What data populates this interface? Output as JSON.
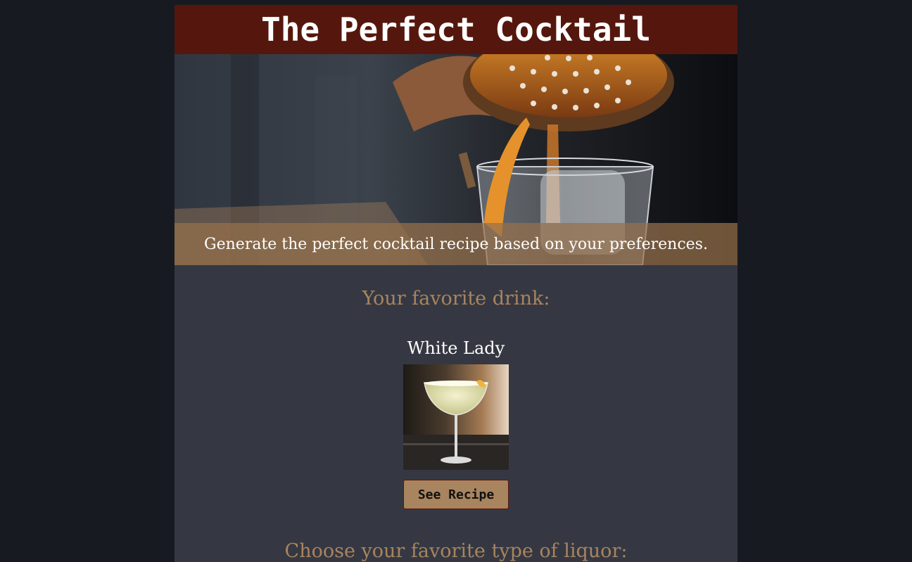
{
  "header": {
    "title": "The Perfect Cocktail"
  },
  "hero": {
    "image_name": "cocktail-pouring-image",
    "caption": "Generate the perfect cocktail recipe based on your preferences."
  },
  "favorite": {
    "heading": "Your favorite drink:",
    "drink_name": "White Lady",
    "image_name": "white-lady-cocktail-image",
    "button_label": "See Recipe"
  },
  "liquor": {
    "heading": "Choose your favorite type of liquor:"
  },
  "colors": {
    "background": "#171a21",
    "panel": "#353842",
    "header": "#55170d",
    "accent": "#a8845f",
    "text": "#ffffff"
  }
}
